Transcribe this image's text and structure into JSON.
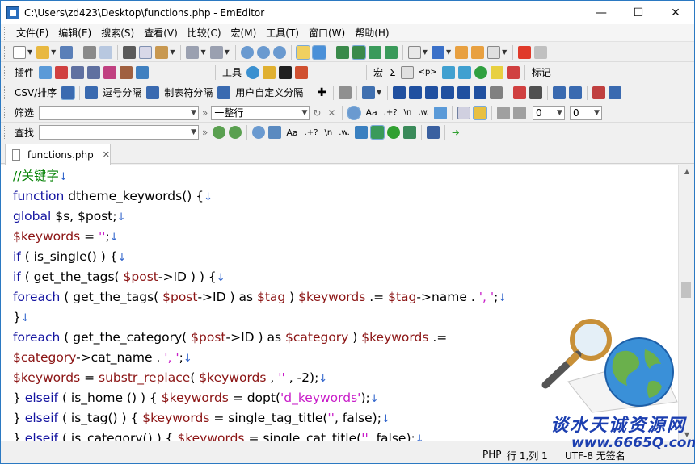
{
  "window": {
    "title": "C:\\Users\\zd423\\Desktop\\functions.php - EmEditor",
    "minimize": "—",
    "maximize": "☐",
    "close": "✕"
  },
  "menu": [
    "文件(F)",
    "编辑(E)",
    "搜索(S)",
    "查看(V)",
    "比较(C)",
    "宏(M)",
    "工具(T)",
    "窗口(W)",
    "帮助(H)"
  ],
  "toolbar_labels": {
    "plugins": "插件",
    "tools": "工具",
    "macros": "宏",
    "bookmarks": "标记",
    "csv_sort": "CSV/排序",
    "comma_sep": "逗号分隔",
    "tab_sep": "制表符分隔",
    "user_sep": "用户自定义分隔"
  },
  "filter_bar": {
    "label": "筛选",
    "value": "",
    "mode": "一整行",
    "num1": "0",
    "num2": "0"
  },
  "find_bar": {
    "label": "查找",
    "value": ""
  },
  "tab": {
    "label": "functions.php",
    "close": "✕"
  },
  "code": [
    [
      [
        "c",
        "//关键字"
      ],
      [
        "rm",
        "↓"
      ]
    ],
    [
      [
        "k",
        "function"
      ],
      [
        "n",
        " dtheme_keywords() {"
      ],
      [
        "rm",
        "↓"
      ]
    ],
    [
      [
        "n",
        "  "
      ],
      [
        "k",
        "global"
      ],
      [
        "n",
        " $s, $post;"
      ],
      [
        "rm",
        "↓"
      ]
    ],
    [
      [
        "n",
        "  "
      ],
      [
        "v",
        "$keywords"
      ],
      [
        "n",
        " = "
      ],
      [
        "s",
        "''"
      ],
      [
        "n",
        ";"
      ],
      [
        "rm",
        "↓"
      ]
    ],
    [
      [
        "n",
        "  "
      ],
      [
        "k",
        "if"
      ],
      [
        "n",
        " ( is_single() ) {"
      ],
      [
        "rm",
        "↓"
      ]
    ],
    [
      [
        "n",
        "    "
      ],
      [
        "k",
        "if"
      ],
      [
        "n",
        " ( get_the_tags( "
      ],
      [
        "v",
        "$post"
      ],
      [
        "n",
        "->ID ) ) {"
      ],
      [
        "rm",
        "↓"
      ]
    ],
    [
      [
        "n",
        "      "
      ],
      [
        "k",
        "foreach"
      ],
      [
        "n",
        " ( get_the_tags( "
      ],
      [
        "v",
        "$post"
      ],
      [
        "n",
        "->ID ) as "
      ],
      [
        "v",
        "$tag"
      ],
      [
        "n",
        " ) "
      ],
      [
        "v",
        "$keywords"
      ],
      [
        "n",
        " .= "
      ],
      [
        "v",
        "$tag"
      ],
      [
        "n",
        "->name . "
      ],
      [
        "s",
        "', '"
      ],
      [
        "n",
        ";"
      ],
      [
        "rm",
        "↓"
      ]
    ],
    [
      [
        "n",
        "    }"
      ],
      [
        "rm",
        "↓"
      ]
    ],
    [
      [
        "n",
        "    "
      ],
      [
        "k",
        "foreach"
      ],
      [
        "n",
        " ( get_the_category( "
      ],
      [
        "v",
        "$post"
      ],
      [
        "n",
        "->ID ) as "
      ],
      [
        "v",
        "$category"
      ],
      [
        "n",
        " ) "
      ],
      [
        "v",
        "$keywords"
      ],
      [
        "n",
        " .="
      ]
    ],
    [
      [
        "v",
        "$category"
      ],
      [
        "n",
        "->cat_name . "
      ],
      [
        "s",
        "', '"
      ],
      [
        "n",
        ";"
      ],
      [
        "rm",
        "↓"
      ]
    ],
    [
      [
        "n",
        "    "
      ],
      [
        "v",
        "$keywords"
      ],
      [
        "n",
        " = "
      ],
      [
        "v",
        "substr_replace"
      ],
      [
        "n",
        "( "
      ],
      [
        "v",
        "$keywords"
      ],
      [
        "n",
        " , "
      ],
      [
        "s",
        "''"
      ],
      [
        "n",
        " , -2);"
      ],
      [
        "rm",
        "↓"
      ]
    ],
    [
      [
        "n",
        "  } "
      ],
      [
        "k",
        "elseif"
      ],
      [
        "n",
        " ( is_home () )     { "
      ],
      [
        "v",
        "$keywords"
      ],
      [
        "n",
        " = dopt("
      ],
      [
        "s",
        "'d_keywords'"
      ],
      [
        "n",
        ");"
      ],
      [
        "rm",
        "↓"
      ]
    ],
    [
      [
        "n",
        "  } "
      ],
      [
        "k",
        "elseif"
      ],
      [
        "n",
        " ( is_tag() )       { "
      ],
      [
        "v",
        "$keywords"
      ],
      [
        "n",
        " = single_tag_title("
      ],
      [
        "s",
        "''"
      ],
      [
        "n",
        ", false);"
      ],
      [
        "rm",
        "↓"
      ]
    ],
    [
      [
        "n",
        "  } "
      ],
      [
        "k",
        "elseif"
      ],
      [
        "n",
        " ( is_category() ) { "
      ],
      [
        "v",
        "$keywords"
      ],
      [
        "n",
        " = single_cat_title("
      ],
      [
        "s",
        "''"
      ],
      [
        "n",
        ", false);"
      ],
      [
        "rm",
        "↓"
      ]
    ]
  ],
  "status": {
    "language": "PHP",
    "position": "行 1,列 1",
    "encoding": "UTF-8 无签名"
  },
  "watermark": {
    "line1": "谈水天诚资源网",
    "line2": "www.6665Q.com"
  },
  "colors": {
    "keyword": "#1414a0",
    "variable": "#8b1414",
    "string": "#c81cc8",
    "comment": "#008000",
    "return_mark": "#3366cc"
  }
}
